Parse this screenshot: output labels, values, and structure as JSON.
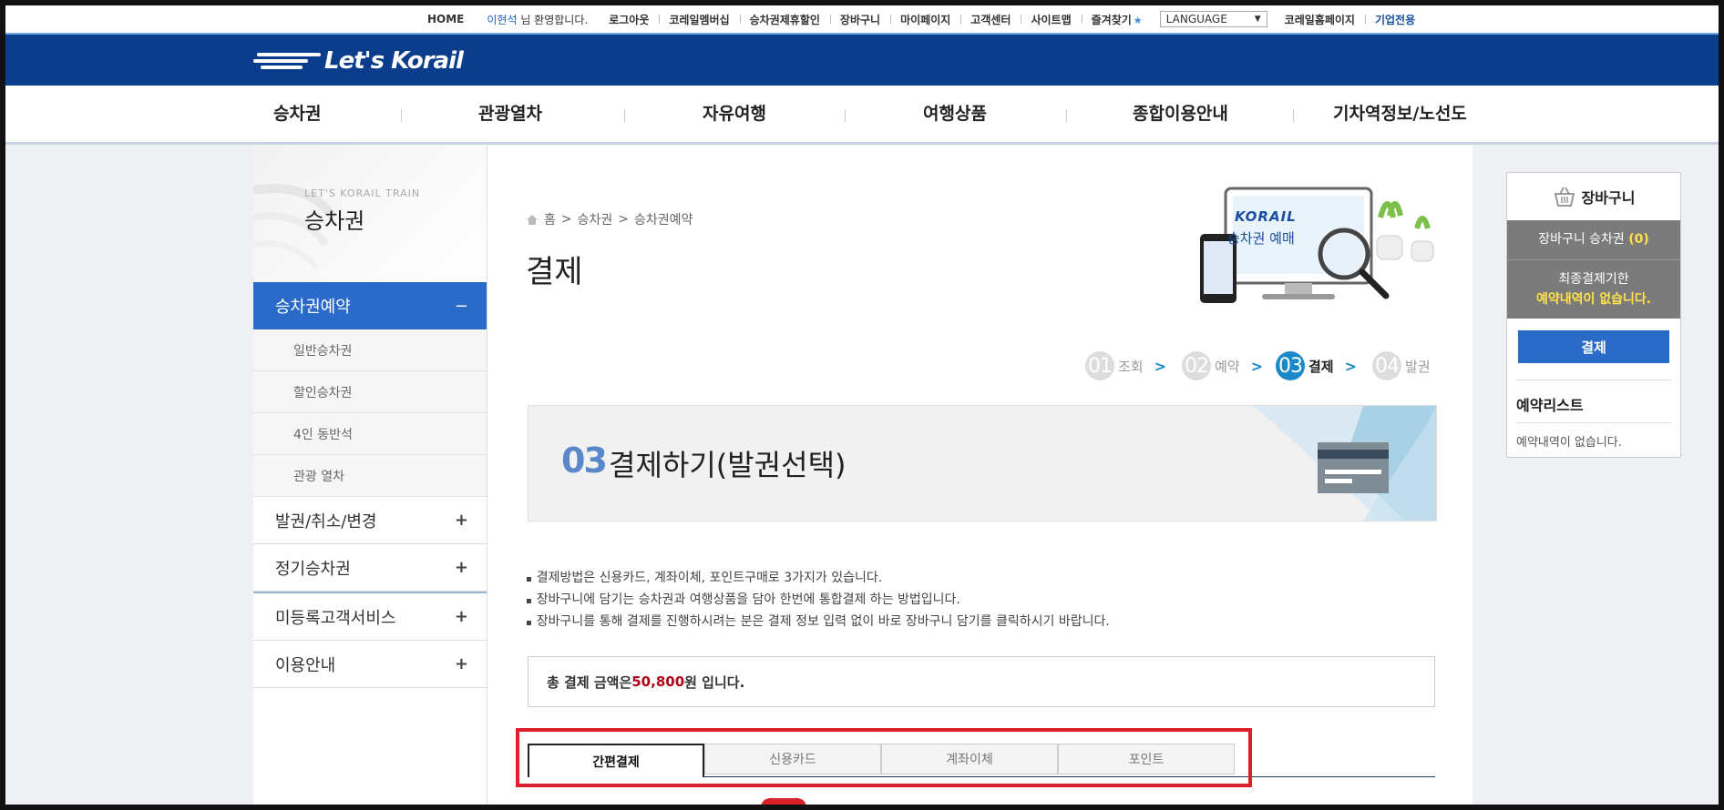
{
  "topbar": {
    "home": "HOME",
    "welcome_name": "이현석",
    "welcome_suffix": " 님 환영합니다.",
    "links": [
      "로그아웃",
      "코레일멤버십",
      "승차권제휴할인",
      "장바구니",
      "마이페이지",
      "고객센터",
      "사이트맵",
      "즐겨찾기"
    ],
    "language": "LANGUAGE",
    "homepage": "코레일홈페이지",
    "corporate": "기업전용"
  },
  "header": {
    "logo": "Let's Korail"
  },
  "gnb": [
    "승차권",
    "관광열차",
    "자유여행",
    "여행상품",
    "종합이용안내",
    "기차역정보/노선도"
  ],
  "lnb": {
    "subtitle": "LET'S KORAIL TRAIN",
    "title": "승차권",
    "active": {
      "label": "승차권예약",
      "toggle": "−"
    },
    "sub_items": [
      "일반승차권",
      "할인승차권",
      "4인 동반석",
      "관광 열차"
    ],
    "categories": [
      {
        "label": "발권/취소/변경",
        "toggle": "+"
      },
      {
        "label": "정기승차권",
        "toggle": "+"
      },
      {
        "label": "미등록고객서비스",
        "toggle": "+"
      },
      {
        "label": "이용안내",
        "toggle": "+"
      }
    ]
  },
  "breadcrumb": [
    "홈",
    "승차권",
    "승차권예약"
  ],
  "page_title": "결제",
  "deco": {
    "brand": "KORAIL",
    "caption": "승차권 예매"
  },
  "steps": [
    {
      "num": "01",
      "label": "조회"
    },
    {
      "num": "02",
      "label": "예약"
    },
    {
      "num": "03",
      "label": "결제"
    },
    {
      "num": "04",
      "label": "발권"
    }
  ],
  "banner": {
    "num": "03",
    "text": "결제하기(발권선택)"
  },
  "notes": [
    "결제방법은 신용카드, 계좌이체, 포인트구매로 3가지가 있습니다.",
    "장바구니에 담기는 승차권과 여행상품을 담아 한번에 통합결제 하는 방법입니다.",
    "장바구니를 통해 결제를 진행하시려는 분은 결제 정보 입력 없이 바로 장바구니 담기를 클릭하시기 바랍니다."
  ],
  "total": {
    "prefix": "총 결제 금액은 ",
    "amount": "50,800",
    "suffix": "원 입니다."
  },
  "tabs": [
    "간편결제",
    "신용카드",
    "계좌이체",
    "포인트"
  ],
  "cart": {
    "title": "장바구니",
    "ticket_label": "장바구니 승차권 ",
    "ticket_count": "(0)",
    "deadline_label": "최종결제기한",
    "deadline_value": "예약내역이 없습니다.",
    "pay_button": "결제",
    "reservation_title": "예약리스트",
    "reservation_empty": "예약내역이 없습니다."
  },
  "colors": {
    "header_blue": "#0a3d8c",
    "accent_blue": "#2a6ac8",
    "step_blue": "#1a89c9",
    "amount_red": "#b30016",
    "highlight_red": "#d9202b"
  }
}
